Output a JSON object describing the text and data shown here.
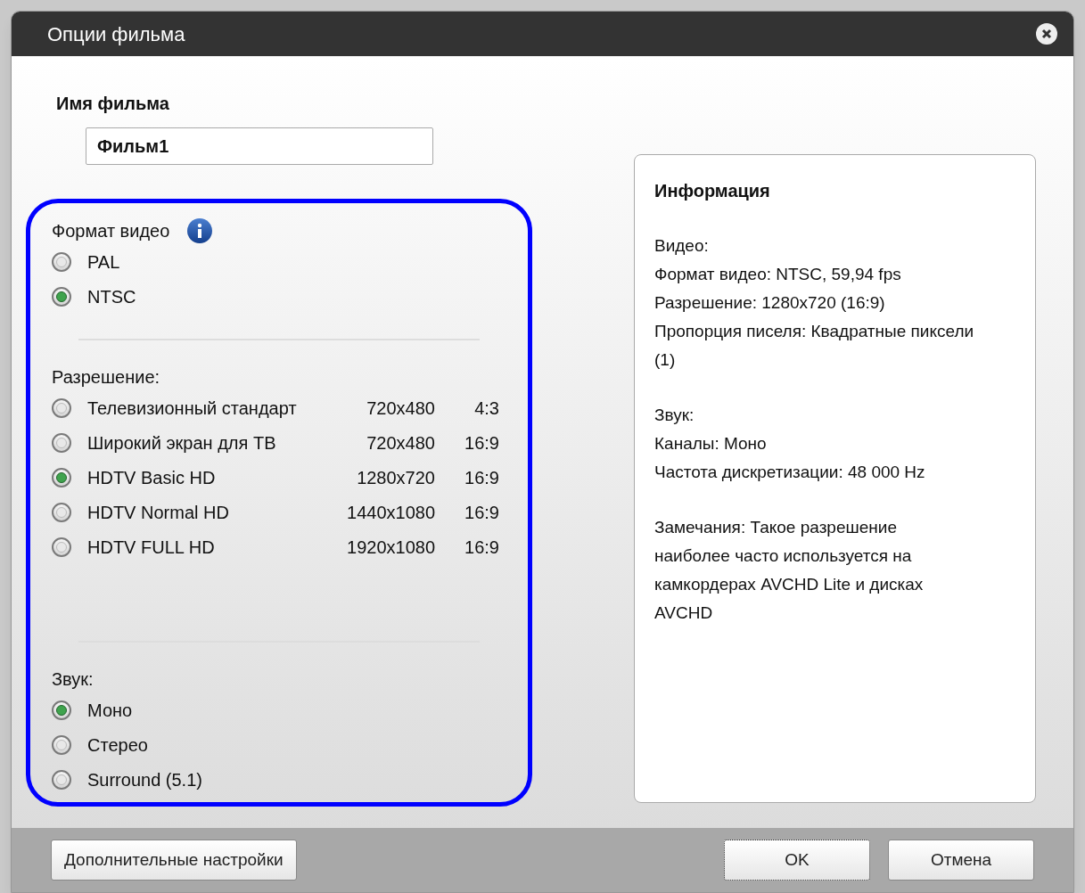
{
  "window": {
    "title": "Опции фильма"
  },
  "movie_name": {
    "label": "Имя фильма",
    "value": "Фильм1"
  },
  "video_format": {
    "label": "Формат видео",
    "options": [
      {
        "label": "PAL",
        "selected": false
      },
      {
        "label": "NTSC",
        "selected": true
      }
    ]
  },
  "resolution": {
    "label": "Разрешение:",
    "options": [
      {
        "label": "Телевизионный стандарт",
        "size": "720x480",
        "aspect": "4:3",
        "selected": false
      },
      {
        "label": "Широкий экран для ТВ",
        "size": "720x480",
        "aspect": "16:9",
        "selected": false
      },
      {
        "label": "HDTV Basic HD",
        "size": "1280x720",
        "aspect": "16:9",
        "selected": true
      },
      {
        "label": "HDTV Normal HD",
        "size": "1440x1080",
        "aspect": "16:9",
        "selected": false
      },
      {
        "label": "HDTV FULL HD",
        "size": "1920x1080",
        "aspect": "16:9",
        "selected": false
      }
    ]
  },
  "sound": {
    "label": "Звук:",
    "options": [
      {
        "label": "Моно",
        "selected": true
      },
      {
        "label": "Стерео",
        "selected": false
      },
      {
        "label": "Surround (5.1)",
        "selected": false
      }
    ]
  },
  "info": {
    "title": "Информация",
    "paragraphs": [
      [
        "Видео:",
        "Формат видео: NTSC, 59,94 fps",
        "Разрешение: 1280x720 (16:9)",
        "Пропорция писеля: Квадратные пиксели (1)"
      ],
      [
        "Звук:",
        "Каналы: Моно",
        "Частота дискретизации: 48 000 Hz"
      ],
      [
        "Замечания: Такое разрешение наиболее часто используется на камкордерах AVCHD Lite и дисках AVCHD"
      ]
    ]
  },
  "buttons": {
    "advanced": "Дополнительные настройки",
    "ok": "OK",
    "cancel": "Отмена"
  }
}
